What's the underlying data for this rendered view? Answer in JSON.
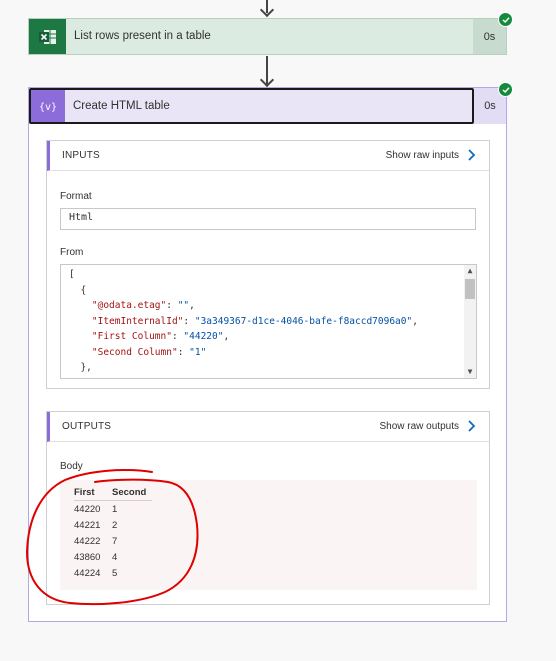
{
  "steps": [
    {
      "title": "List rows present in a table",
      "duration": "0s",
      "status": "succeeded",
      "icon": "excel-icon"
    },
    {
      "title": "Create HTML table",
      "duration": "0s",
      "status": "succeeded",
      "icon": "data-operation-icon",
      "icon_glyph": "{v}",
      "inputs": {
        "label": "INPUTS",
        "show_raw": "Show raw inputs",
        "format_label": "Format",
        "format_value": "Html",
        "from_label": "From",
        "from_lines": [
          {
            "p": "[",
            "k": "",
            "v": ""
          },
          {
            "p": "  {",
            "k": "",
            "v": ""
          },
          {
            "p": "    ",
            "k": "\"@odata.etag\"",
            "sep": ": ",
            "v": "\"\"",
            "end": ","
          },
          {
            "p": "    ",
            "k": "\"ItemInternalId\"",
            "sep": ": ",
            "v": "\"3a349367-d1ce-4046-bafe-f8accd7096a0\"",
            "end": ","
          },
          {
            "p": "    ",
            "k": "\"First Column\"",
            "sep": ": ",
            "v": "\"44220\"",
            "end": ","
          },
          {
            "p": "    ",
            "k": "\"Second Column\"",
            "sep": ": ",
            "v": "\"1\"",
            "end": ""
          },
          {
            "p": "  },",
            "k": "",
            "v": ""
          },
          {
            "p": "  {",
            "k": "",
            "v": ""
          }
        ]
      },
      "outputs": {
        "label": "OUTPUTS",
        "show_raw": "Show raw outputs",
        "body_label": "Body",
        "table": {
          "headers": [
            "First",
            "Second"
          ],
          "rows": [
            [
              "44220",
              "1"
            ],
            [
              "44221",
              "2"
            ],
            [
              "44222",
              "7"
            ],
            [
              "43860",
              "4"
            ],
            [
              "44224",
              "5"
            ]
          ]
        }
      }
    }
  ],
  "colors": {
    "excel_green": "#1d7844",
    "step1_bg": "#dcebe2",
    "action_purple": "#8c6cd8",
    "step2_bg": "#e9e5f6",
    "success": "#138a3c",
    "annotation_red": "#e00000"
  }
}
